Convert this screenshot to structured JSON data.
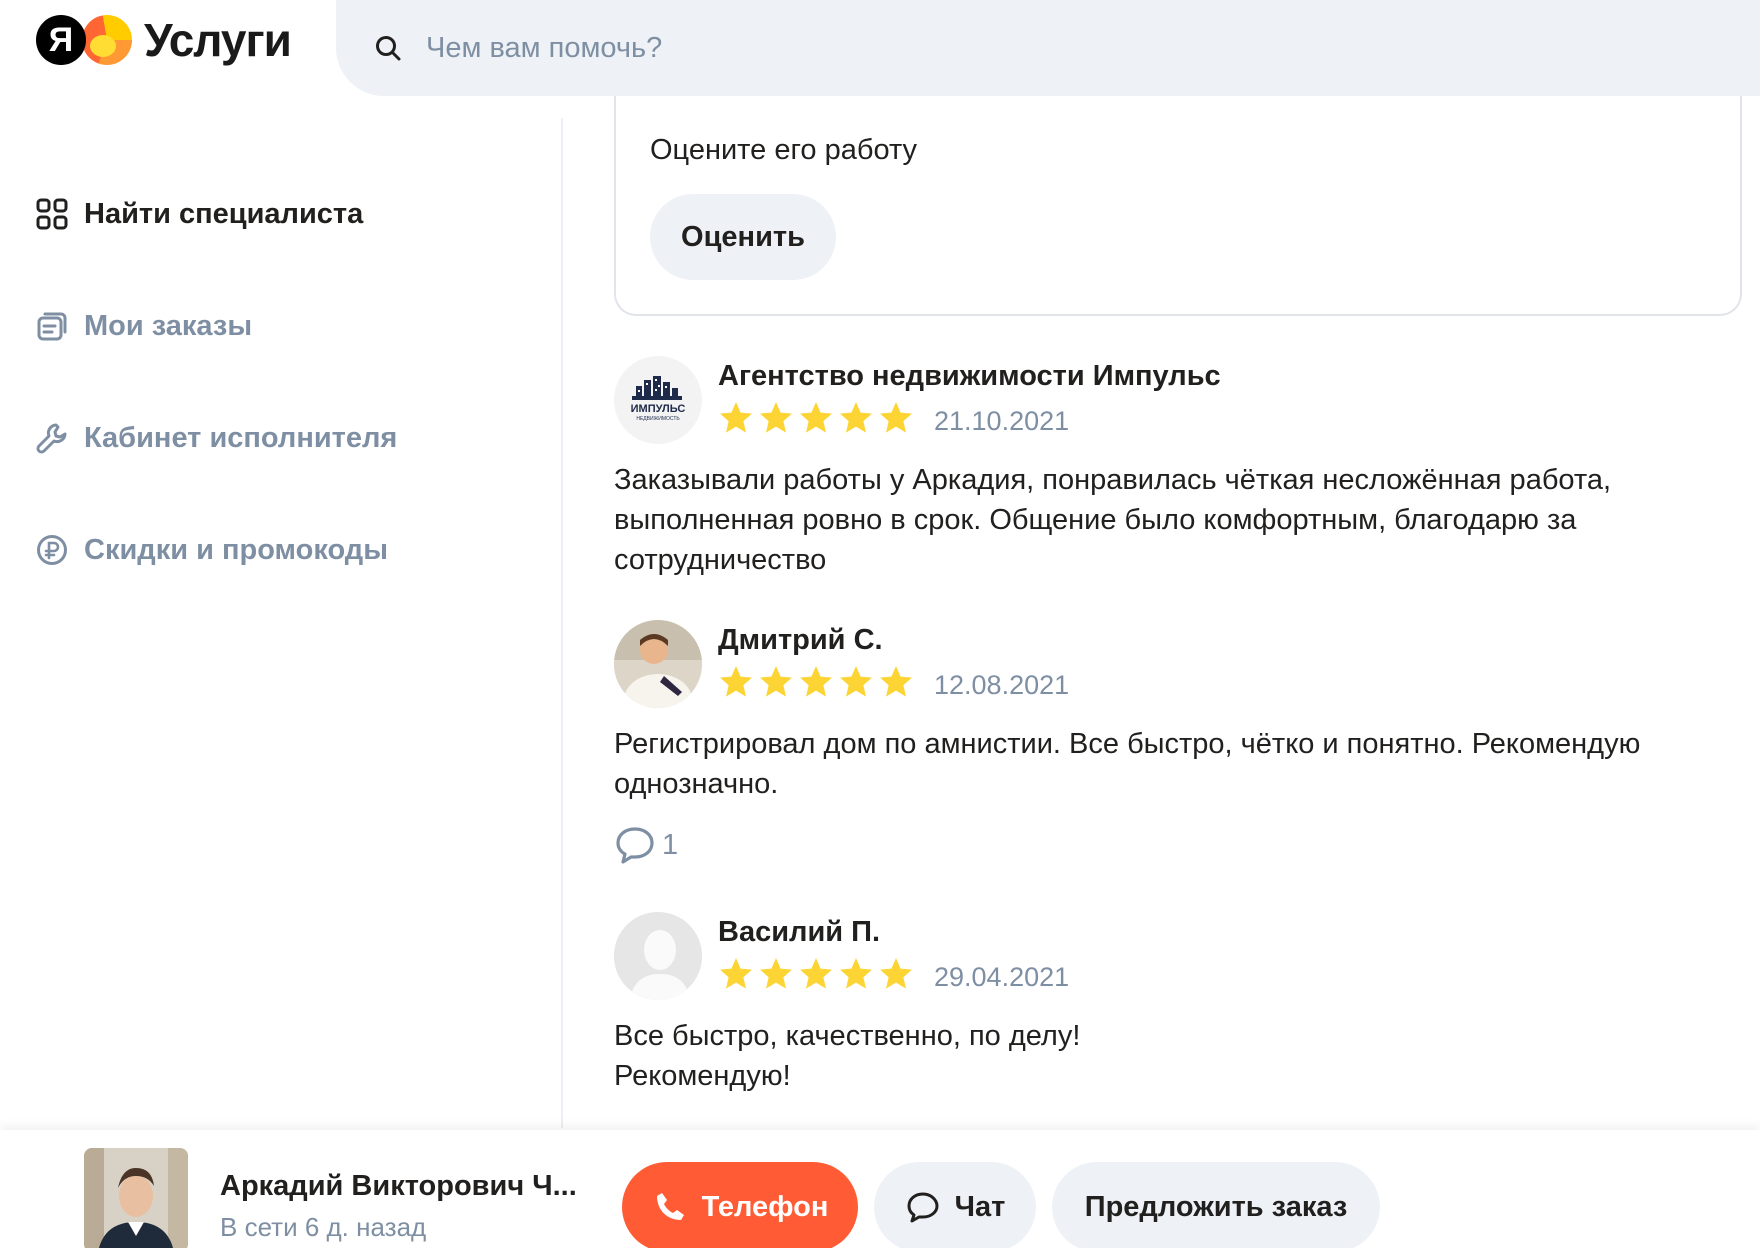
{
  "header": {
    "logo_ya": "Я",
    "logo_text": "Услуги",
    "search_placeholder": "Чем вам помочь?",
    "search_icon": "search-icon"
  },
  "sidebar": {
    "items": [
      {
        "label": "Найти специалиста",
        "icon": "grid-icon",
        "active": true
      },
      {
        "label": "Мои заказы",
        "icon": "orders-icon",
        "active": false
      },
      {
        "label": "Кабинет исполнителя",
        "icon": "wrench-icon",
        "active": false
      },
      {
        "label": "Скидки и промокоды",
        "icon": "ruble-icon",
        "active": false
      }
    ]
  },
  "rate_card": {
    "prompt": "Оцените его работу",
    "button_label": "Оценить"
  },
  "reviews": [
    {
      "author": "Агентство недвижимости Импульс",
      "avatar_text": "ИМПУЛЬС",
      "avatar_subtext": "НЕДВИЖИМОСТЬ",
      "rating": 5,
      "date": "21.10.2021",
      "text": "Заказывали работы у Аркадия, понравилась чёткая несложённая работа,\nвыполненная ровно в срок. Общение было комфортным, благодарю за\nсотрудничество"
    },
    {
      "author": "Дмитрий С.",
      "rating": 5,
      "date": "12.08.2021",
      "text": "Регистрировал дом по амнистии. Все быстро, чётко и понятно. Рекомендую\nоднозначно.",
      "comments": "1"
    },
    {
      "author": "Василий П.",
      "rating": 5,
      "date": "29.04.2021",
      "text": "Все быстро, качественно, по делу!\nРекомендую!"
    }
  ],
  "bottom_bar": {
    "name": "Аркадий Викторович Ч...",
    "status": "В сети 6 д. назад",
    "phone_label": "Телефон",
    "chat_label": "Чат",
    "order_label": "Предложить заказ"
  },
  "colors": {
    "accent": "#ff5c35",
    "star": "#fcd535",
    "muted_text": "#7f8fa3",
    "button_bg": "#eef2f6"
  }
}
